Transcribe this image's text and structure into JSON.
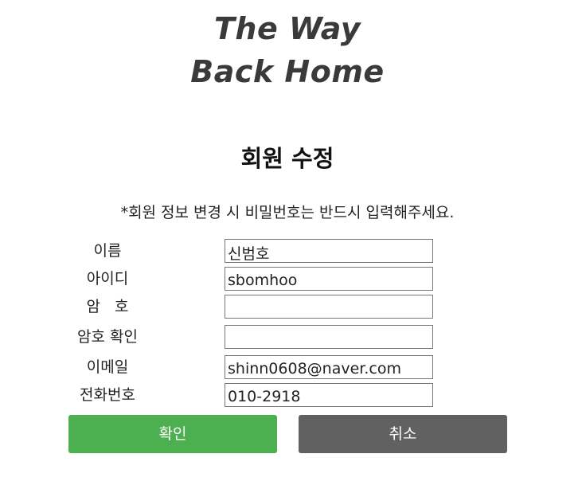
{
  "logo": {
    "line1": "The Way",
    "line2": "Back Home"
  },
  "page": {
    "title": "회원 수정",
    "notice": "*회원 정보 변경 시 비밀번호는 반드시 입력해주세요."
  },
  "form": {
    "name": {
      "label": "이름",
      "value": "신범호"
    },
    "user_id": {
      "label": "아이디",
      "value": "sbomhoo"
    },
    "password": {
      "label": "암   호",
      "value": ""
    },
    "password_confirm": {
      "label": "암호 확인",
      "value": ""
    },
    "email": {
      "label": "이메일",
      "value": "shinn0608@naver.com"
    },
    "phone": {
      "label": "전화번호",
      "value": "010-2918"
    }
  },
  "buttons": {
    "confirm": "확인",
    "cancel": "취소"
  },
  "colors": {
    "confirm_button": "#4caf50",
    "cancel_button": "#616161",
    "logo_text": "#3a3a3a"
  }
}
